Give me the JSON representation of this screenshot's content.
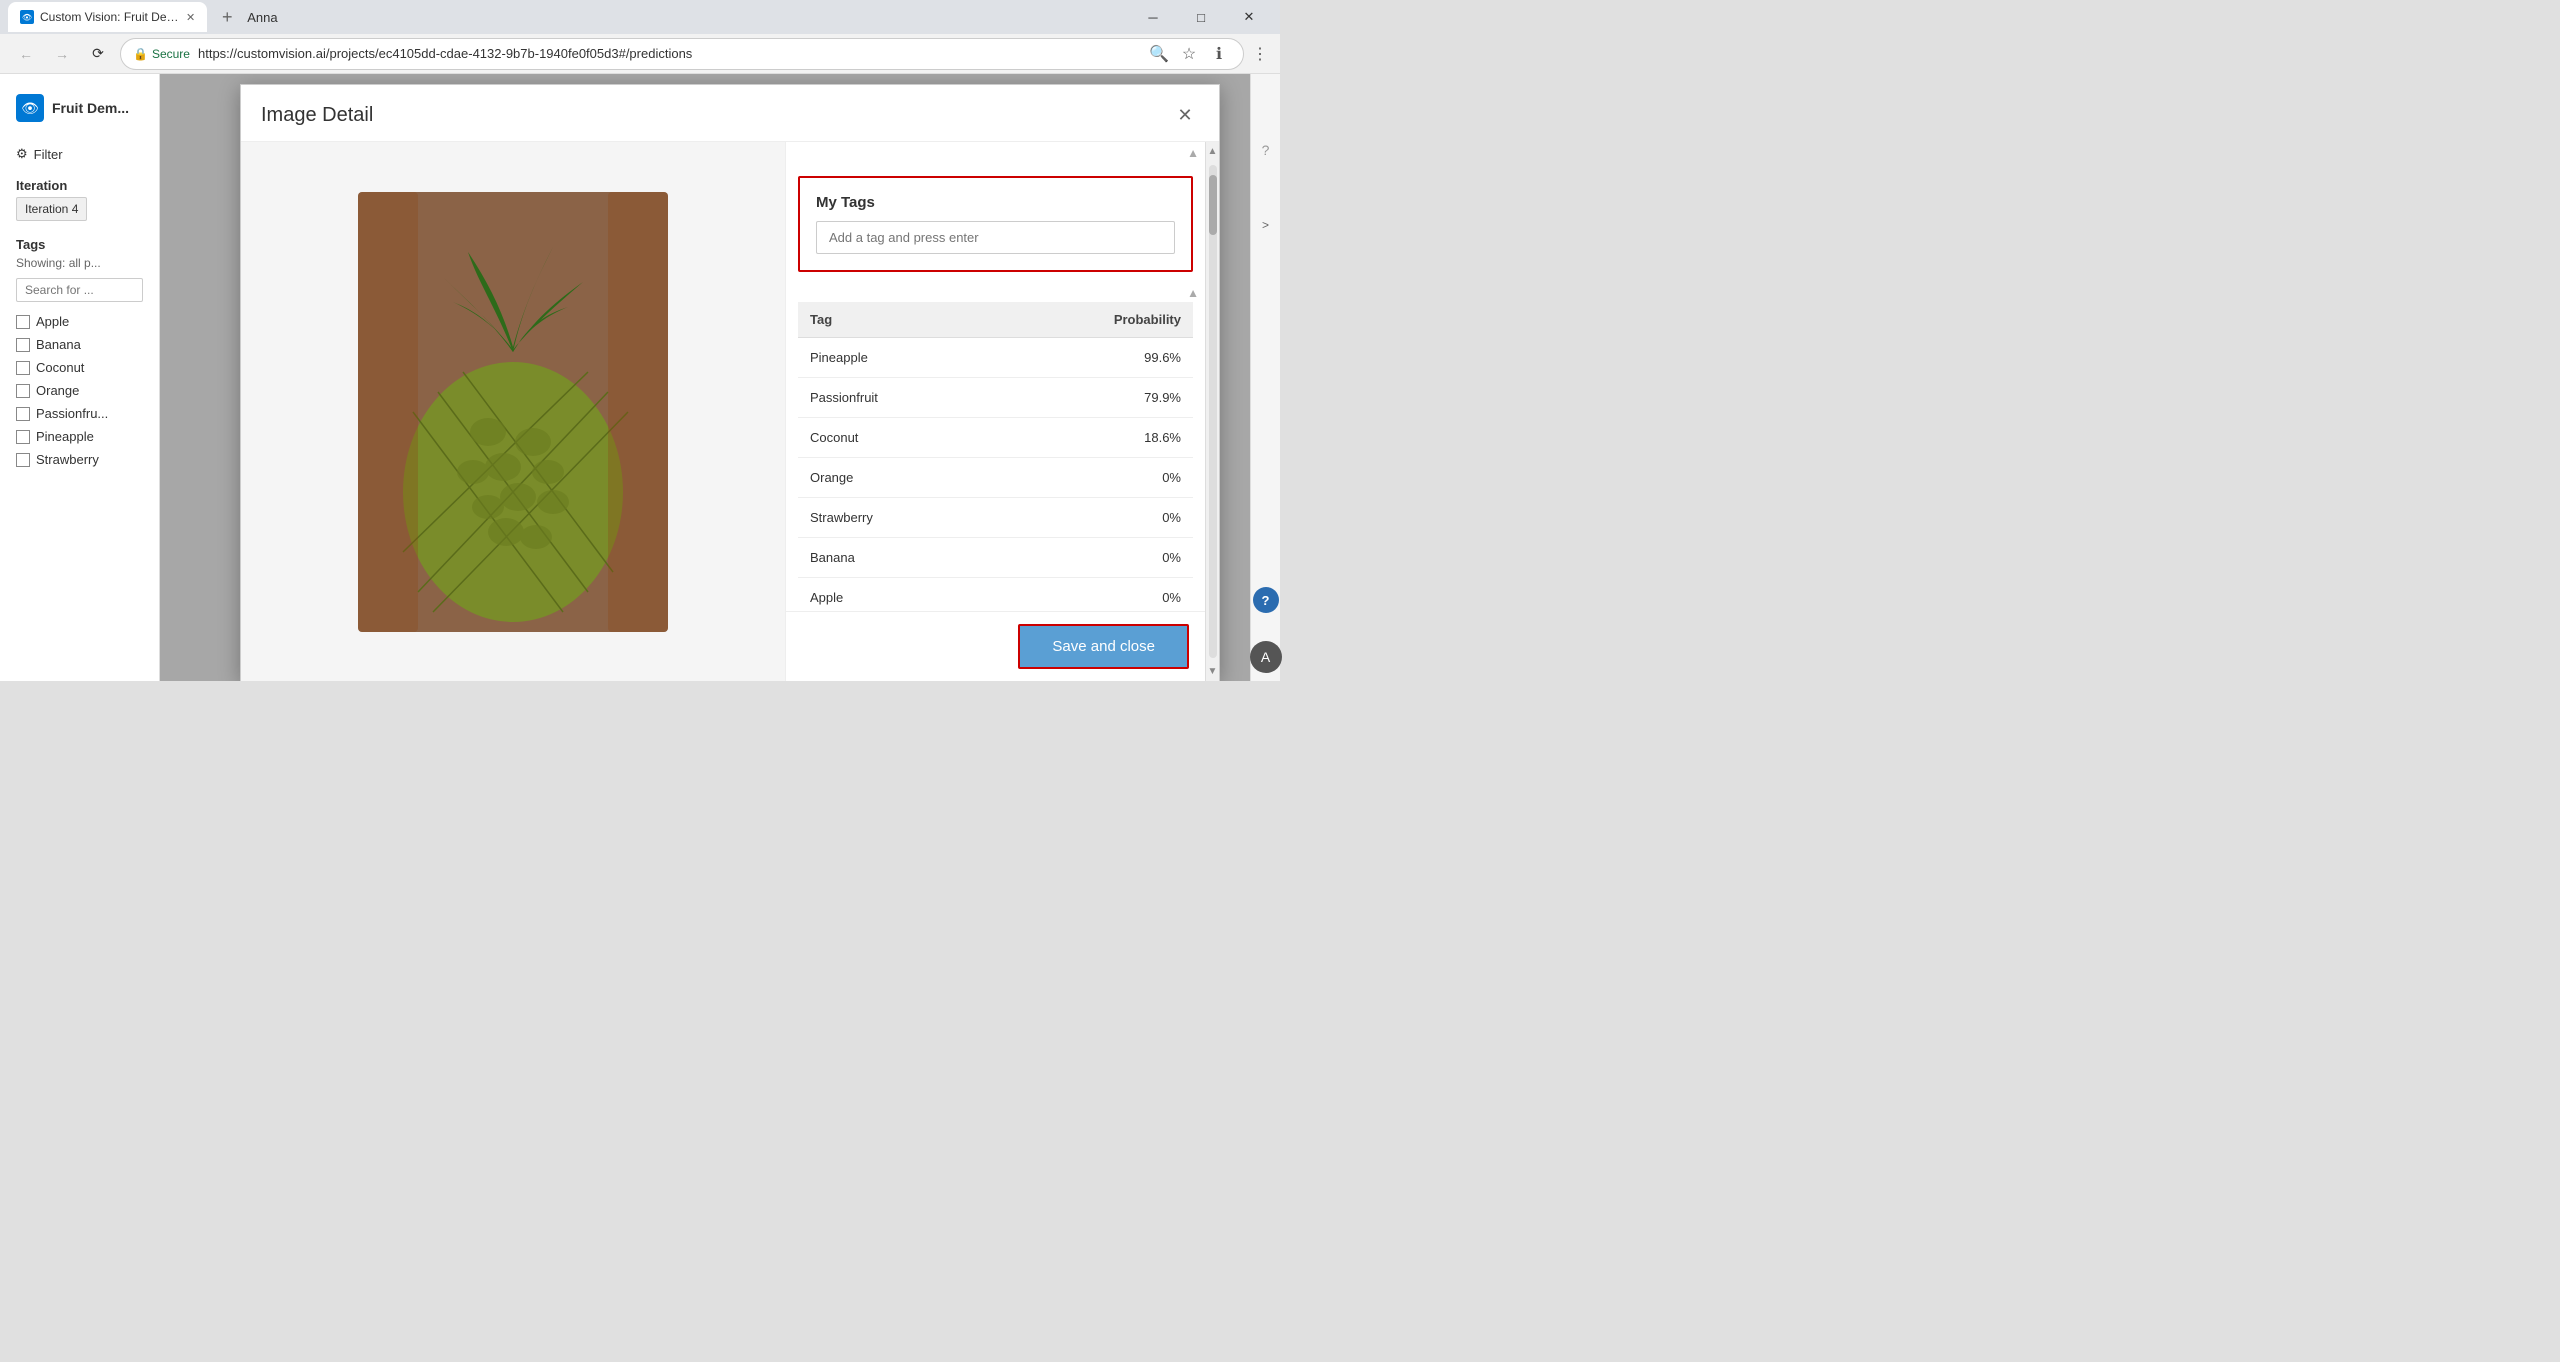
{
  "browser": {
    "tab_title": "Custom Vision: Fruit Dem...",
    "url_secure_label": "Secure",
    "url": "https://customvision.ai/projects/ec4105dd-cdae-4132-9b7b-1940fe0f05d3#/predictions",
    "user_name": "Anna",
    "window_minimize": "─",
    "window_maximize": "□",
    "window_close": "✕"
  },
  "sidebar": {
    "logo_label": "CV",
    "project_title": "Fruit Dem...",
    "filter_label": "Filter",
    "iteration_section_title": "Iteration",
    "iteration_showing_label": "Iteration 4",
    "tags_section_title": "Tags",
    "tags_showing_label": "Showing: all p...",
    "search_placeholder": "Search for ...",
    "tags": [
      {
        "label": "Apple",
        "checked": false
      },
      {
        "label": "Banana",
        "checked": false
      },
      {
        "label": "Coconut",
        "checked": false
      },
      {
        "label": "Orange",
        "checked": false
      },
      {
        "label": "Passionfru...",
        "checked": false
      },
      {
        "label": "Pineapple",
        "checked": false
      },
      {
        "label": "Strawberry",
        "checked": false
      }
    ]
  },
  "modal": {
    "title": "Image Detail",
    "close_label": "✕",
    "my_tags_title": "My Tags",
    "tag_input_placeholder": "Add a tag and press enter",
    "table": {
      "col_tag": "Tag",
      "col_probability": "Probability",
      "rows": [
        {
          "tag": "Pineapple",
          "probability": "99.6%"
        },
        {
          "tag": "Passionfruit",
          "probability": "79.9%"
        },
        {
          "tag": "Coconut",
          "probability": "18.6%"
        },
        {
          "tag": "Orange",
          "probability": "0%"
        },
        {
          "tag": "Strawberry",
          "probability": "0%"
        },
        {
          "tag": "Banana",
          "probability": "0%"
        },
        {
          "tag": "Apple",
          "probability": "0%"
        }
      ]
    },
    "save_close_label": "Save and close"
  },
  "right_panel": {
    "arrow_label": ">",
    "help_label": "?",
    "question_label": "?"
  }
}
